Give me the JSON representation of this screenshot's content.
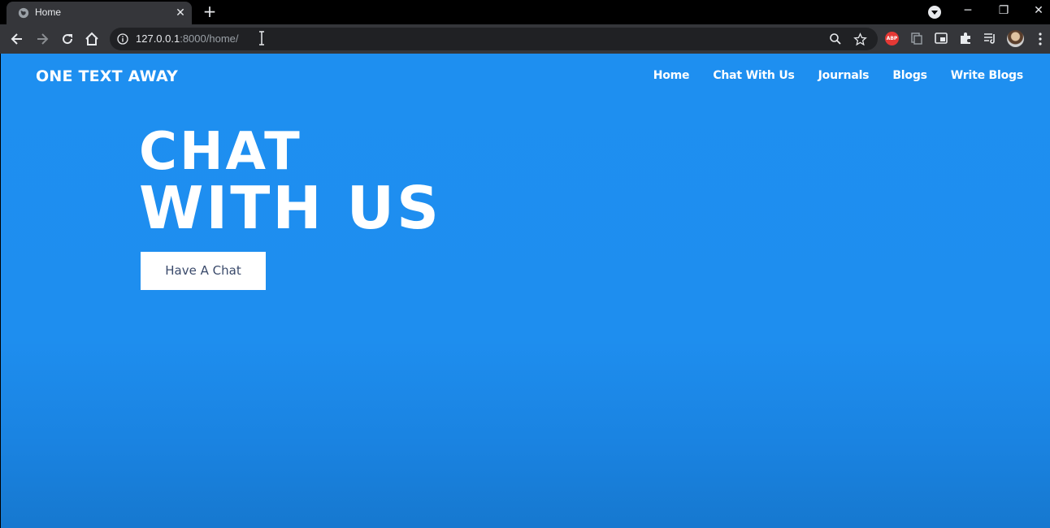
{
  "browser": {
    "tab": {
      "title": "Home",
      "close_glyph": "✕"
    },
    "new_tab_glyph": "+",
    "window_controls": {
      "minimize": "─",
      "restore": "❐",
      "close": "✕"
    },
    "address_bar": {
      "host": "127.0.0.1",
      "path": ":8000/home/"
    },
    "extensions": {
      "abp_label": "ABP"
    },
    "icons": [
      "globe-icon",
      "back-icon",
      "forward-icon",
      "reload-icon",
      "home-icon",
      "info-icon",
      "zoom-icon",
      "star-icon",
      "adblock-icon",
      "copy-extension-icon",
      "cast-icon",
      "puzzle-icon",
      "reading-list-icon",
      "avatar",
      "kebab-menu-icon"
    ]
  },
  "page": {
    "brand": "ONE TEXT AWAY",
    "nav": [
      {
        "label": "Home"
      },
      {
        "label": "Chat With Us"
      },
      {
        "label": "Journals"
      },
      {
        "label": "Blogs"
      },
      {
        "label": "Write Blogs"
      }
    ],
    "hero": {
      "line1": "CHAT",
      "line2": "WITH US",
      "cta_label": "Have A Chat"
    }
  },
  "colors": {
    "page_background": "#1e8ff0",
    "cta_text": "#3a4a6b",
    "chrome_toolbar": "#35363a",
    "omnibox": "#202124"
  }
}
